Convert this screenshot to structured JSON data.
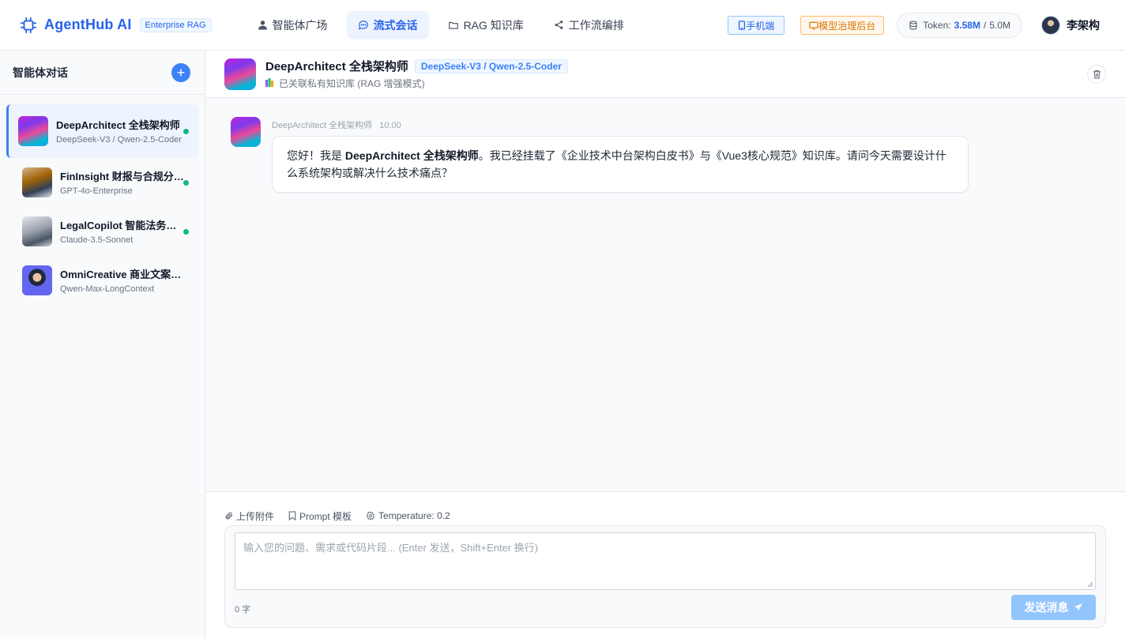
{
  "brand": {
    "name": "AgentHub AI",
    "badge": "Enterprise RAG",
    "icon": "cpu-icon"
  },
  "nav": [
    {
      "label": "智能体广场",
      "icon": "user-icon",
      "active": false
    },
    {
      "label": "流式会话",
      "icon": "chat-bubble-icon",
      "active": true
    },
    {
      "label": "RAG 知识库",
      "icon": "folder-icon",
      "active": false
    },
    {
      "label": "工作流编排",
      "icon": "share-nodes-icon",
      "active": false
    }
  ],
  "header_right": {
    "mobile_label": "手机端",
    "admin_label": "模型治理后台",
    "token": {
      "label": "Token:",
      "used": "3.58M",
      "separator": "/",
      "total": "5.0M"
    },
    "user_name": "李架构"
  },
  "sidebar": {
    "title": "智能体对话",
    "agents": [
      {
        "name": "DeepArchitect 全栈架构师",
        "model": "DeepSeek-V3 / Qwen-2.5-Coder",
        "online": true,
        "active": true
      },
      {
        "name": "FinInsight 财报与合规分析师",
        "model": "GPT-4o-Enterprise",
        "online": true,
        "active": false
      },
      {
        "name": "LegalCopilot 智能法务顾问",
        "model": "Claude-3.5-Sonnet",
        "online": true,
        "active": false
      },
      {
        "name": "OmniCreative 商业文案与创意",
        "model": "Qwen-Max-LongContext",
        "online": false,
        "active": false
      }
    ]
  },
  "chat": {
    "agent_name": "DeepArchitect 全栈架构师",
    "model_tag": "DeepSeek-V3 / Qwen-2.5-Coder",
    "kb_status": "已关联私有知识库 (RAG 增强模式)",
    "messages": [
      {
        "sender": "DeepArchitect 全栈架构师",
        "time": "10:00",
        "text_before": "您好！我是 ",
        "text_bold": "DeepArchitect 全栈架构师",
        "text_after": "。我已经挂载了《企业技术中台架构白皮书》与《Vue3核心规范》知识库。请问今天需要设计什么系统架构或解决什么技术痛点？"
      }
    ]
  },
  "composer": {
    "tools": [
      {
        "label": "上传附件",
        "icon": "paperclip-icon"
      },
      {
        "label": "Prompt 模板",
        "icon": "bookmark-icon"
      },
      {
        "label": "Temperature: 0.2",
        "icon": "gear-icon"
      }
    ],
    "placeholder": "输入您的问题、需求或代码片段... (Enter 发送，Shift+Enter 换行)",
    "char_count": "0 字",
    "send_label": "发送消息"
  },
  "colors": {
    "accent": "#2563eb",
    "online": "#10b981",
    "send_disabled": "#93c5fd"
  }
}
